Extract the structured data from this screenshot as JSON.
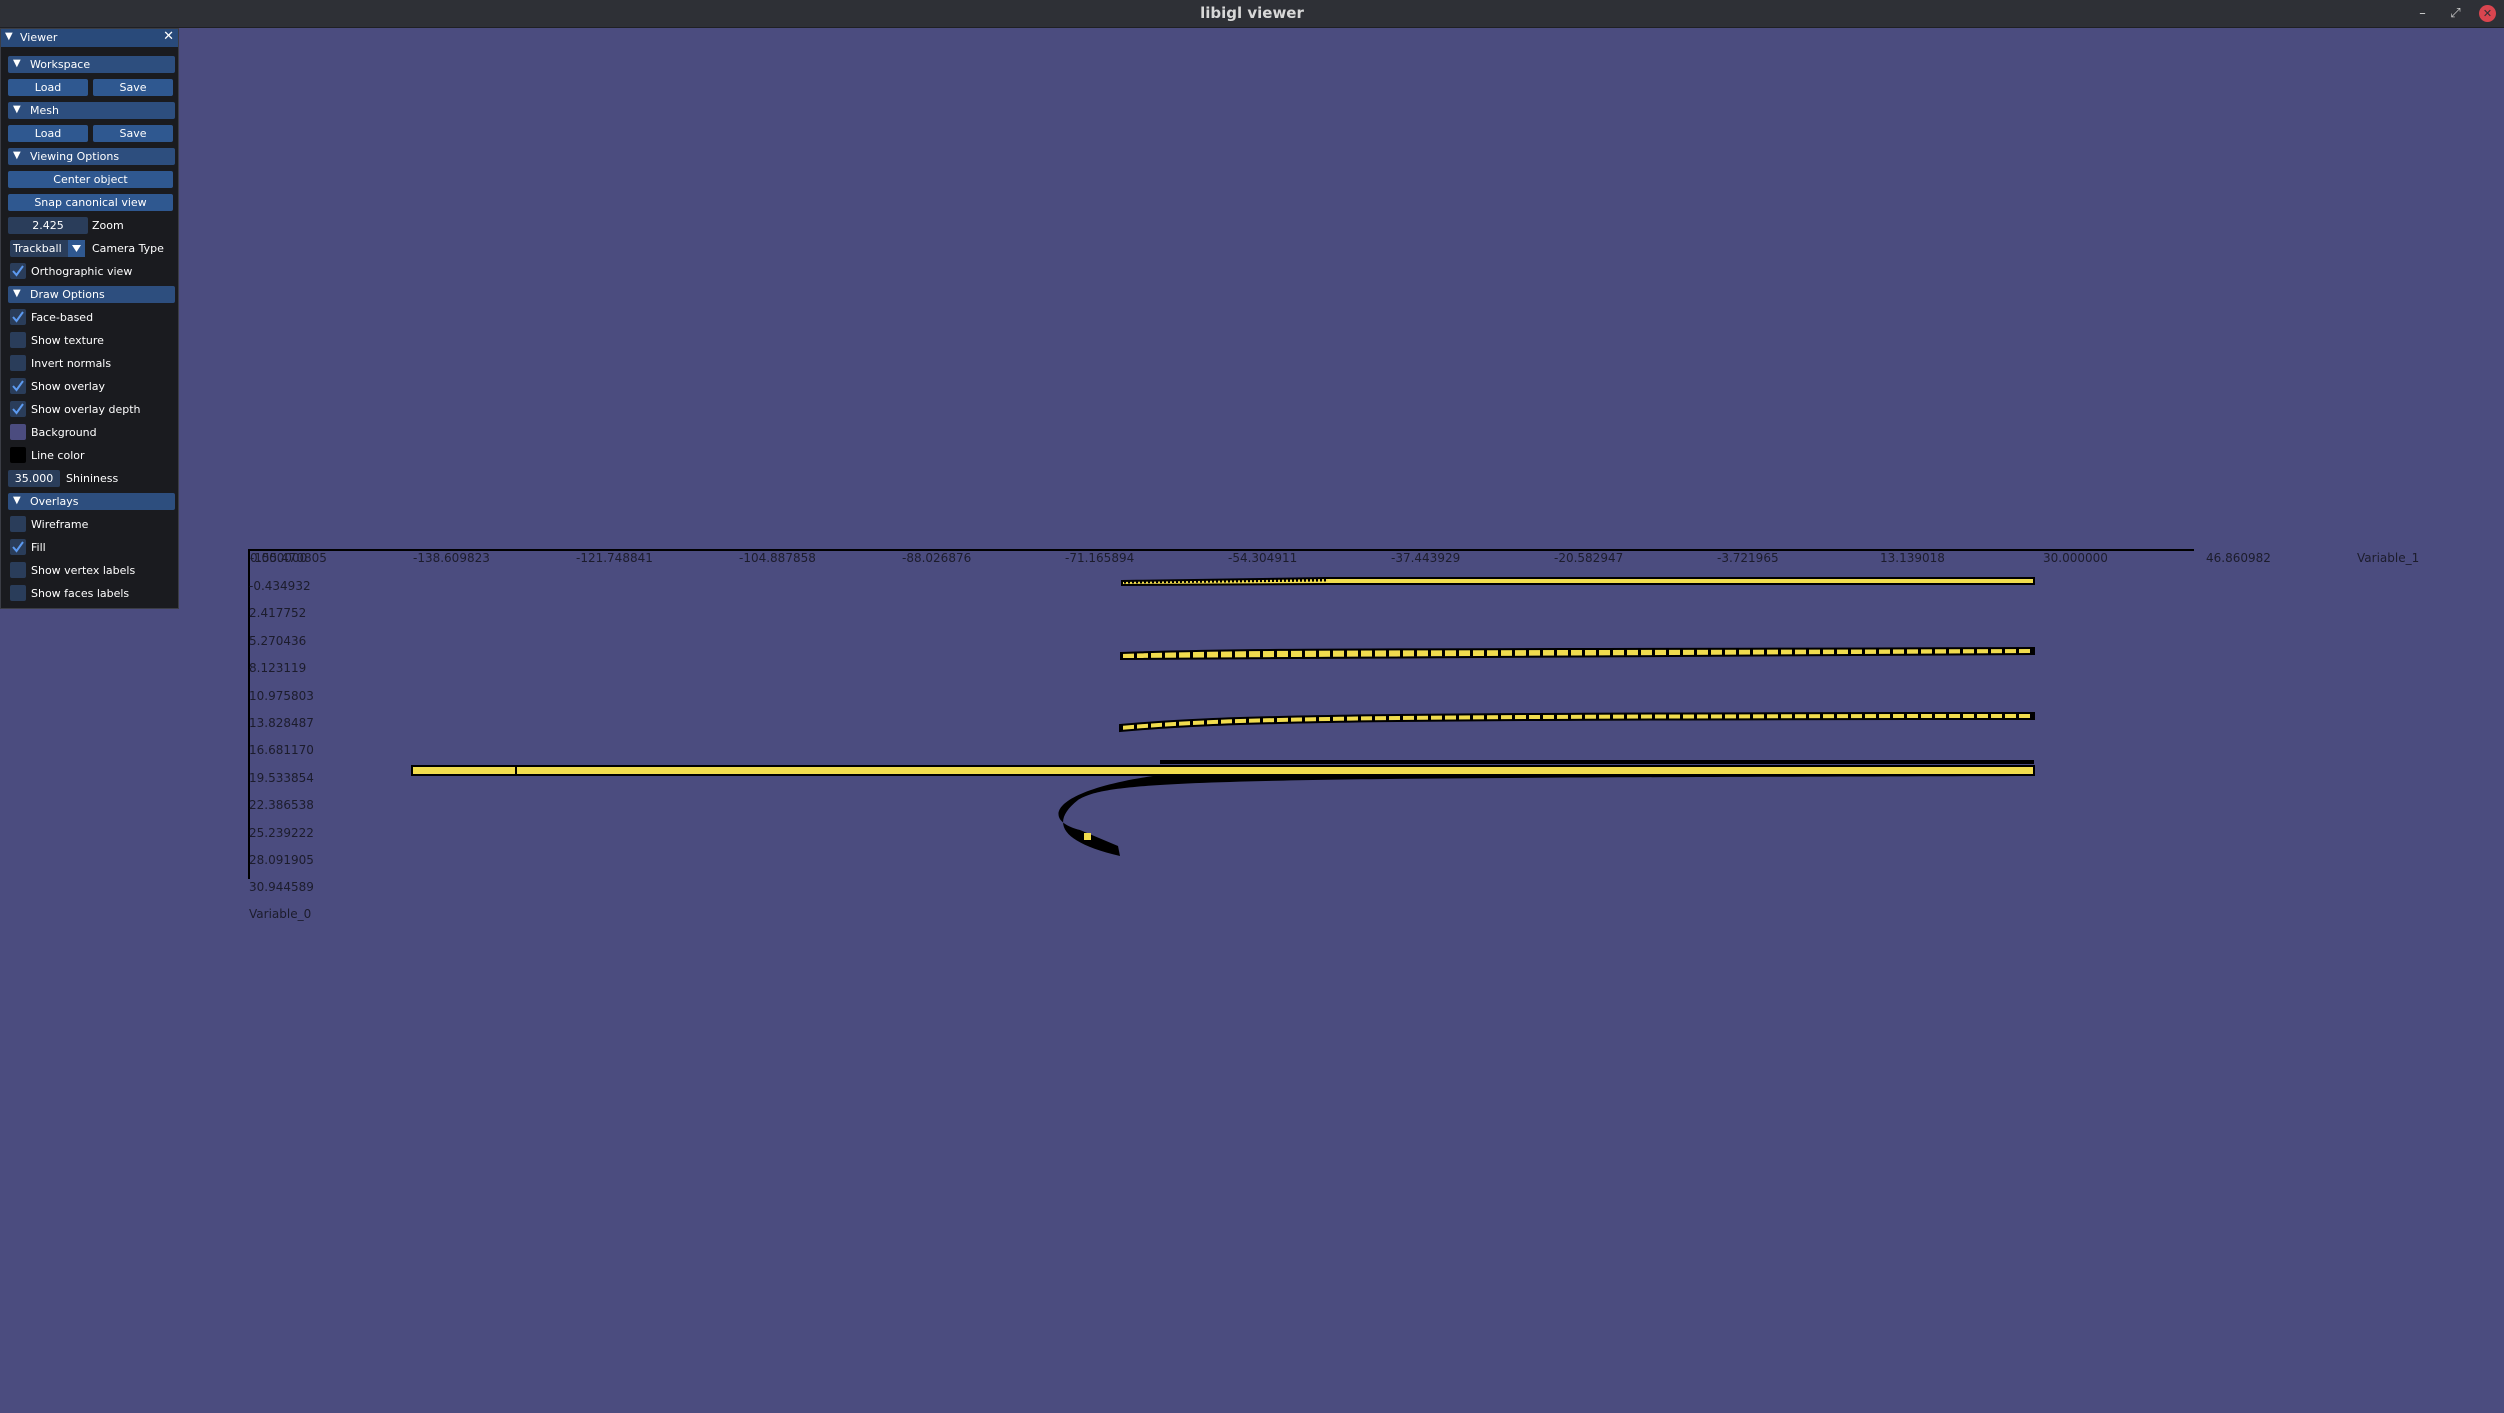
{
  "window": {
    "title": "libigl viewer",
    "minimize_glyph": "–",
    "maximize_glyph": "⤢",
    "close_glyph": "✕"
  },
  "panel": {
    "title": "Viewer",
    "workspace": {
      "header": "Workspace",
      "load": "Load",
      "save": "Save"
    },
    "mesh": {
      "header": "Mesh",
      "load": "Load",
      "save": "Save"
    },
    "viewing": {
      "header": "Viewing Options",
      "center": "Center object",
      "snap": "Snap canonical view",
      "zoom_value": "2.425",
      "zoom_label": "Zoom",
      "camera_value": "Trackball",
      "camera_label": "Camera Type",
      "ortho_label": "Orthographic view",
      "ortho_checked": true
    },
    "draw": {
      "header": "Draw Options",
      "face_based": "Face-based",
      "show_texture": "Show texture",
      "invert_normals": "Invert normals",
      "show_overlay": "Show overlay",
      "show_overlay_depth": "Show overlay depth",
      "background": "Background",
      "line_color": "Line color",
      "shininess_value": "35.000",
      "shininess_label": "Shininess",
      "background_color": "#4b4c7f",
      "line_color_value": "#000000"
    },
    "overlays": {
      "header": "Overlays",
      "wireframe": "Wireframe",
      "fill": "Fill",
      "vertex_labels": "Show vertex labels",
      "faces_labels": "Show faces labels"
    }
  },
  "plot": {
    "x_ticks": [
      "-155.470805",
      "-138.609823",
      "-121.748841",
      "-104.887858",
      "-88.026876",
      "-71.165894",
      "-54.304911",
      "-37.443929",
      "-20.582947",
      "-3.721965",
      "13.139018",
      "30.000000",
      "46.860982"
    ],
    "x_label": "Variable_1",
    "y_ticks": [
      "-0.434932",
      "2.417752",
      "5.270436",
      "8.123119",
      "10.975803",
      "13.828487",
      "16.681170",
      "19.533854",
      "22.386538",
      "25.239222",
      "28.091905",
      "30.944589"
    ],
    "y_label": "Variable_0",
    "origin_label": "0.000000",
    "fill_color": "#f1dc4e"
  }
}
